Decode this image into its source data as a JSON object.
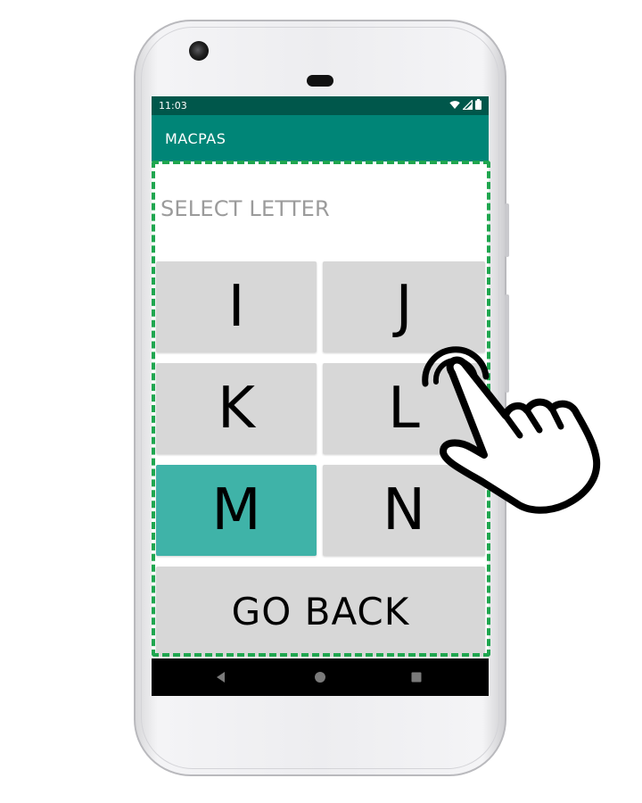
{
  "status_bar": {
    "time": "11:03",
    "icons": [
      "wifi-icon",
      "signal-icon",
      "battery-icon"
    ]
  },
  "app_bar": {
    "title": "MACPAS"
  },
  "prompt": "SELECT LETTER",
  "letters": [
    {
      "label": "I",
      "selected": false
    },
    {
      "label": "J",
      "selected": false
    },
    {
      "label": "K",
      "selected": false
    },
    {
      "label": "L",
      "selected": false
    },
    {
      "label": "M",
      "selected": true
    },
    {
      "label": "N",
      "selected": false
    }
  ],
  "go_back_label": "GO BACK",
  "nav_bar": {
    "icons": [
      "back-triangle-icon",
      "home-circle-icon",
      "recents-square-icon"
    ]
  },
  "colors": {
    "status_bar": "#00574b",
    "app_bar": "#008577",
    "key_default": "#d7d7d7",
    "key_selected": "#3fb3a8",
    "highlight_dash": "#1fa64f"
  },
  "overlay": {
    "icon": "pointing-hand-icon"
  }
}
